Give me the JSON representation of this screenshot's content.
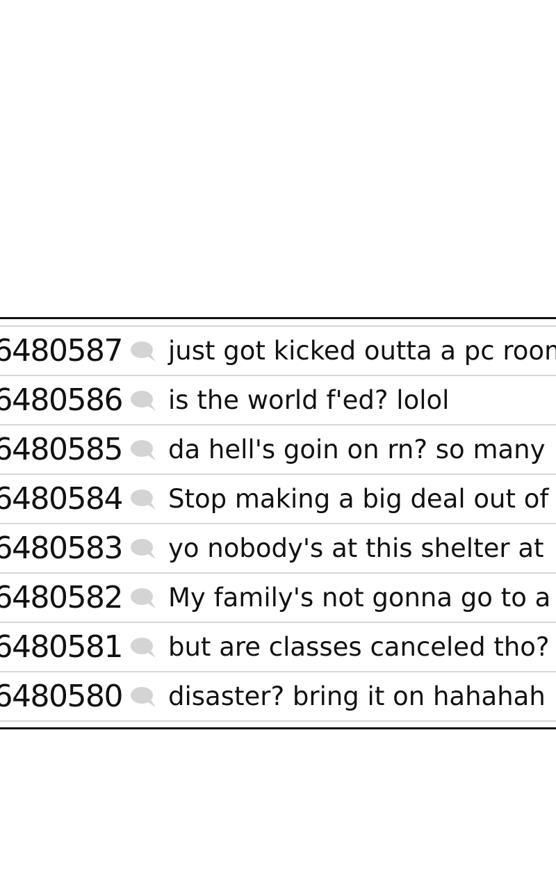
{
  "posts": [
    {
      "id": "6480587",
      "title": "just got kicked outta a pc room"
    },
    {
      "id": "6480586",
      "title": "is the world f'ed? lolol"
    },
    {
      "id": "6480585",
      "title": "da hell's goin on rn? so many"
    },
    {
      "id": "6480584",
      "title": "Stop making a big deal out of"
    },
    {
      "id": "6480583",
      "title": "yo nobody's at this shelter at"
    },
    {
      "id": "6480582",
      "title": "My family's not gonna go to a"
    },
    {
      "id": "6480581",
      "title": "but are classes canceled tho?"
    },
    {
      "id": "6480580",
      "title": "disaster? bring it on hahahah"
    }
  ],
  "icon": "comment-bubble-icon",
  "colors": {
    "text": "#111111",
    "divider": "#d6d6d6",
    "icon": "#d4d4d4",
    "frame": "#111111"
  }
}
